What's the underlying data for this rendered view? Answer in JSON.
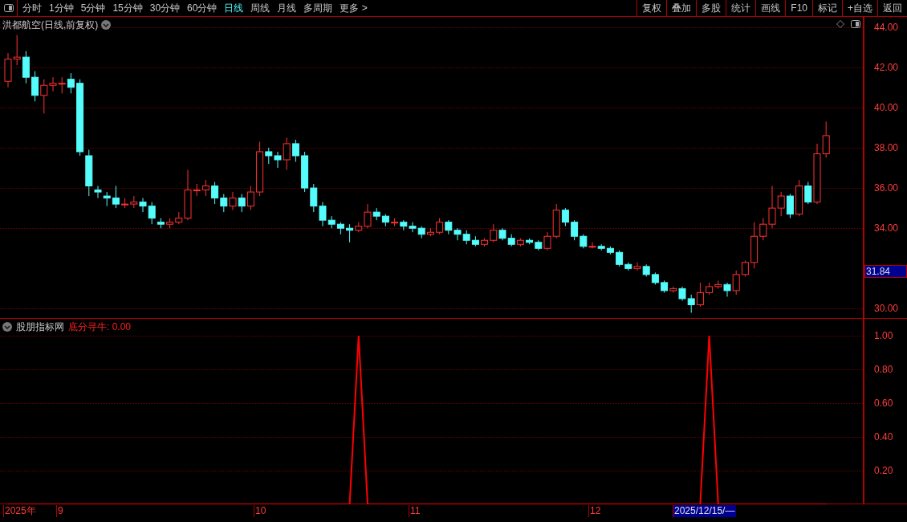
{
  "toolbar": {
    "periods": [
      {
        "label": "分时",
        "selected": false
      },
      {
        "label": "1分钟",
        "selected": false
      },
      {
        "label": "5分钟",
        "selected": false
      },
      {
        "label": "15分钟",
        "selected": false
      },
      {
        "label": "30分钟",
        "selected": false
      },
      {
        "label": "60分钟",
        "selected": false
      },
      {
        "label": "日线",
        "selected": true
      },
      {
        "label": "周线",
        "selected": false
      },
      {
        "label": "月线",
        "selected": false
      },
      {
        "label": "多周期",
        "selected": false
      }
    ],
    "more": "更多 >",
    "buttons": [
      "复权",
      "叠加",
      "多股",
      "统计",
      "画线",
      "F10",
      "标记",
      "+自选",
      "返回"
    ]
  },
  "price_chart": {
    "title": "洪都航空(日线,前复权)",
    "current_price": "31.84",
    "chart_data": {
      "type": "candlestick",
      "ylim": [
        29.5,
        44.5
      ],
      "yticks": [
        {
          "value": 44,
          "label": "44.00"
        },
        {
          "value": 42,
          "label": "42.00"
        },
        {
          "value": 40,
          "label": "40.00"
        },
        {
          "value": 38,
          "label": "38.00"
        },
        {
          "value": 36,
          "label": "36.00"
        },
        {
          "value": 34,
          "label": "34.00"
        },
        {
          "value": 30,
          "label": "30.00"
        }
      ],
      "grid": true,
      "ohlc": [
        [
          41.3,
          42.7,
          41.0,
          42.4
        ],
        [
          42.4,
          43.6,
          42.1,
          42.5
        ],
        [
          42.5,
          42.8,
          41.2,
          41.5
        ],
        [
          41.5,
          41.8,
          40.3,
          40.6
        ],
        [
          40.6,
          41.4,
          39.7,
          41.1
        ],
        [
          41.1,
          41.5,
          40.8,
          41.2
        ],
        [
          41.2,
          41.5,
          40.7,
          41.2
        ],
        [
          41.4,
          41.7,
          40.7,
          41.0
        ],
        [
          41.2,
          41.4,
          37.6,
          37.8
        ],
        [
          37.6,
          37.9,
          35.6,
          36.1
        ],
        [
          35.9,
          36.1,
          35.5,
          35.8
        ],
        [
          35.6,
          35.8,
          35.1,
          35.5
        ],
        [
          35.5,
          36.1,
          35.0,
          35.2
        ],
        [
          35.2,
          35.5,
          35.0,
          35.2
        ],
        [
          35.2,
          35.6,
          35.0,
          35.3
        ],
        [
          35.3,
          35.5,
          34.8,
          35.1
        ],
        [
          35.1,
          35.3,
          34.2,
          34.5
        ],
        [
          34.3,
          34.5,
          34.0,
          34.2
        ],
        [
          34.2,
          34.5,
          34.0,
          34.3
        ],
        [
          34.3,
          34.8,
          34.2,
          34.5
        ],
        [
          34.5,
          36.9,
          34.4,
          35.9
        ],
        [
          35.9,
          36.2,
          35.6,
          35.9
        ],
        [
          35.9,
          36.4,
          35.6,
          36.1
        ],
        [
          36.1,
          36.3,
          35.2,
          35.5
        ],
        [
          35.5,
          35.7,
          34.8,
          35.1
        ],
        [
          35.1,
          35.8,
          34.9,
          35.5
        ],
        [
          35.5,
          35.7,
          34.8,
          35.1
        ],
        [
          35.1,
          36.1,
          34.9,
          35.8
        ],
        [
          35.8,
          38.3,
          35.6,
          37.8
        ],
        [
          37.8,
          38.0,
          37.2,
          37.6
        ],
        [
          37.6,
          37.8,
          37.0,
          37.4
        ],
        [
          37.4,
          38.5,
          36.9,
          38.2
        ],
        [
          38.2,
          38.4,
          37.3,
          37.6
        ],
        [
          37.6,
          37.8,
          35.8,
          36.0
        ],
        [
          36.0,
          36.2,
          34.8,
          35.1
        ],
        [
          35.1,
          35.3,
          34.1,
          34.4
        ],
        [
          34.4,
          34.6,
          34.0,
          34.2
        ],
        [
          34.2,
          34.3,
          33.7,
          34.0
        ],
        [
          34.0,
          34.2,
          33.3,
          33.9
        ],
        [
          33.9,
          34.3,
          33.8,
          34.1
        ],
        [
          34.1,
          35.2,
          34.0,
          34.8
        ],
        [
          34.8,
          35.0,
          34.4,
          34.6
        ],
        [
          34.6,
          34.7,
          34.1,
          34.3
        ],
        [
          34.3,
          34.5,
          34.1,
          34.3
        ],
        [
          34.3,
          34.4,
          33.9,
          34.1
        ],
        [
          34.1,
          34.3,
          33.8,
          34.0
        ],
        [
          34.0,
          34.1,
          33.5,
          33.7
        ],
        [
          33.7,
          34.0,
          33.6,
          33.8
        ],
        [
          33.8,
          34.5,
          33.7,
          34.3
        ],
        [
          34.3,
          34.4,
          33.7,
          33.9
        ],
        [
          33.9,
          34.0,
          33.4,
          33.7
        ],
        [
          33.7,
          33.9,
          33.2,
          33.4
        ],
        [
          33.4,
          33.6,
          33.1,
          33.2
        ],
        [
          33.2,
          33.5,
          33.1,
          33.4
        ],
        [
          33.4,
          34.2,
          33.3,
          33.9
        ],
        [
          33.9,
          34.0,
          33.4,
          33.5
        ],
        [
          33.5,
          33.7,
          33.1,
          33.2
        ],
        [
          33.2,
          33.5,
          33.1,
          33.4
        ],
        [
          33.4,
          33.5,
          33.2,
          33.3
        ],
        [
          33.3,
          33.4,
          32.9,
          33.0
        ],
        [
          33.0,
          33.8,
          32.9,
          33.6
        ],
        [
          33.6,
          35.2,
          33.5,
          34.9
        ],
        [
          34.9,
          35.0,
          34.1,
          34.3
        ],
        [
          34.3,
          34.4,
          33.4,
          33.6
        ],
        [
          33.6,
          33.7,
          33.0,
          33.1
        ],
        [
          33.1,
          33.3,
          33.0,
          33.1
        ],
        [
          33.1,
          33.2,
          32.9,
          33.0
        ],
        [
          33.0,
          33.1,
          32.7,
          32.8
        ],
        [
          32.8,
          32.9,
          32.1,
          32.2
        ],
        [
          32.2,
          32.3,
          31.9,
          32.0
        ],
        [
          32.0,
          32.3,
          31.9,
          32.1
        ],
        [
          32.1,
          32.2,
          31.6,
          31.7
        ],
        [
          31.7,
          31.8,
          31.2,
          31.3
        ],
        [
          31.3,
          31.4,
          30.8,
          30.9
        ],
        [
          30.9,
          31.1,
          30.8,
          31.0
        ],
        [
          31.0,
          31.1,
          30.4,
          30.5
        ],
        [
          30.5,
          30.7,
          29.8,
          30.2
        ],
        [
          30.2,
          31.3,
          30.1,
          30.8
        ],
        [
          30.8,
          31.3,
          30.7,
          31.1
        ],
        [
          31.1,
          31.4,
          31.0,
          31.2
        ],
        [
          31.2,
          31.3,
          30.6,
          30.9
        ],
        [
          30.9,
          31.9,
          30.7,
          31.7
        ],
        [
          31.7,
          32.4,
          31.6,
          32.3
        ],
        [
          32.3,
          34.3,
          32.0,
          33.6
        ],
        [
          33.6,
          34.5,
          33.4,
          34.2
        ],
        [
          34.2,
          36.1,
          34.0,
          35.0
        ],
        [
          35.0,
          35.8,
          34.6,
          35.6
        ],
        [
          35.6,
          35.7,
          34.5,
          34.7
        ],
        [
          34.7,
          36.4,
          34.6,
          36.1
        ],
        [
          36.1,
          36.3,
          35.2,
          35.3
        ],
        [
          35.3,
          38.2,
          35.2,
          37.7
        ],
        [
          37.7,
          39.3,
          37.5,
          38.6
        ]
      ]
    }
  },
  "indicator": {
    "source": "股朋指标网",
    "reading": ": 0.00",
    "chart_data": {
      "type": "line",
      "ylim": [
        0,
        1
      ],
      "grid": true,
      "yticks": [
        {
          "value": 0.2,
          "label": "0.20"
        },
        {
          "value": 0.4,
          "label": "0.40"
        },
        {
          "value": 0.6,
          "label": "0.60"
        },
        {
          "value": 0.8,
          "label": "0.80"
        },
        {
          "value": 1,
          "label": "1.00"
        }
      ],
      "series": [
        {
          "name": "底分寻牛",
          "color": "#ff0000",
          "values": [
            0,
            0,
            0,
            0,
            0,
            0,
            0,
            0,
            0,
            0,
            0,
            0,
            0,
            0,
            0,
            0,
            0,
            0,
            0,
            0,
            0,
            0,
            0,
            0,
            0,
            0,
            0,
            0,
            0,
            0,
            0,
            0,
            0,
            0,
            0,
            0,
            0,
            0,
            0,
            1,
            0,
            0,
            0,
            0,
            0,
            0,
            0,
            0,
            0,
            0,
            0,
            0,
            0,
            0,
            0,
            0,
            0,
            0,
            0,
            0,
            0,
            0,
            0,
            0,
            0,
            0,
            0,
            0,
            0,
            0,
            0,
            0,
            0,
            0,
            0,
            0,
            0,
            0,
            1,
            0,
            0,
            0,
            0,
            0,
            0,
            0,
            0,
            0,
            0,
            0,
            0,
            0
          ]
        }
      ]
    }
  },
  "date_axis": {
    "labels": [
      {
        "text": "2025年",
        "selected": false
      },
      {
        "text": "9",
        "selected": false
      },
      {
        "text": "10",
        "selected": false
      },
      {
        "text": "11",
        "selected": false
      },
      {
        "text": "12",
        "selected": false
      },
      {
        "text": "2025/12/15/—",
        "selected": true
      }
    ]
  }
}
